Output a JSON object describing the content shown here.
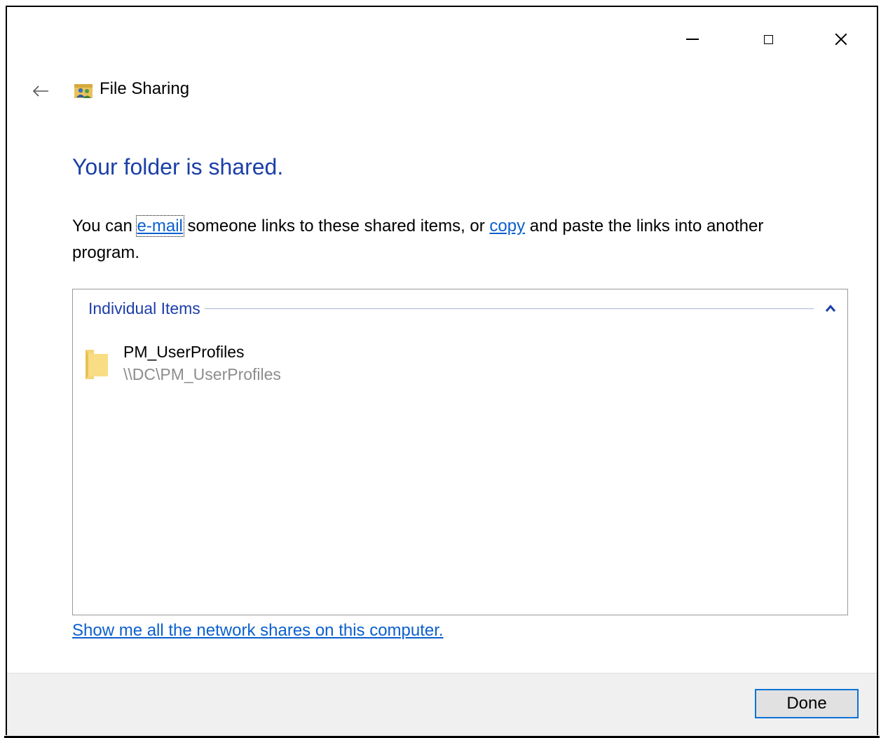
{
  "window": {
    "title": "File Sharing",
    "controls": {
      "minimize": "minimize-icon",
      "maximize": "maximize-icon",
      "close": "close-icon"
    },
    "back_icon": "back-arrow-icon",
    "title_icon": "file-sharing-icon"
  },
  "main": {
    "heading": "Your folder is shared.",
    "description": {
      "before_email": "You can ",
      "email_link": "e-mail",
      "middle": " someone links to these shared items, or ",
      "copy_link": "copy",
      "after_copy": " and paste the links into another program."
    }
  },
  "group": {
    "label": "Individual Items",
    "collapse_icon": "chevron-up-icon",
    "items": [
      {
        "name": "PM_UserProfiles",
        "path": "\\\\DC\\PM_UserProfiles",
        "icon": "folder-icon"
      }
    ]
  },
  "network_link": "Show me all the network shares on this computer.",
  "footer": {
    "done_label": "Done"
  },
  "colors": {
    "heading": "#1c3fa8",
    "link": "#0b5fcf",
    "footer_bg": "#f0f0f0",
    "button_border": "#0a72d6"
  }
}
